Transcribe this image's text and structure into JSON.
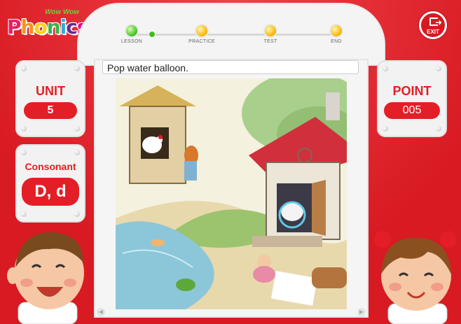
{
  "logo": {
    "small": "Wow Wow",
    "main": [
      "P",
      "h",
      "o",
      "n",
      "i",
      "c",
      "s"
    ]
  },
  "progress": {
    "steps": [
      {
        "label": "LESSON",
        "state": "current"
      },
      {
        "label": "PRACTICE",
        "state": "pending"
      },
      {
        "label": "TEST",
        "state": "pending"
      },
      {
        "label": "END",
        "state": "pending"
      }
    ]
  },
  "exit": {
    "label": "EXIT"
  },
  "caption": "Pop water balloon.",
  "unit": {
    "title": "UNIT",
    "value": "5"
  },
  "consonant": {
    "title": "Consonant",
    "value": "D, d"
  },
  "point": {
    "title": "POINT",
    "value": "005"
  },
  "colors": {
    "brand_red": "#e41e26",
    "panel": "#f2f2f2",
    "done_green": "#3fbf1f",
    "pending_yellow": "#f7b500"
  },
  "icons": [
    "exit-door-icon",
    "prev-arrow-icon",
    "next-arrow-icon"
  ]
}
